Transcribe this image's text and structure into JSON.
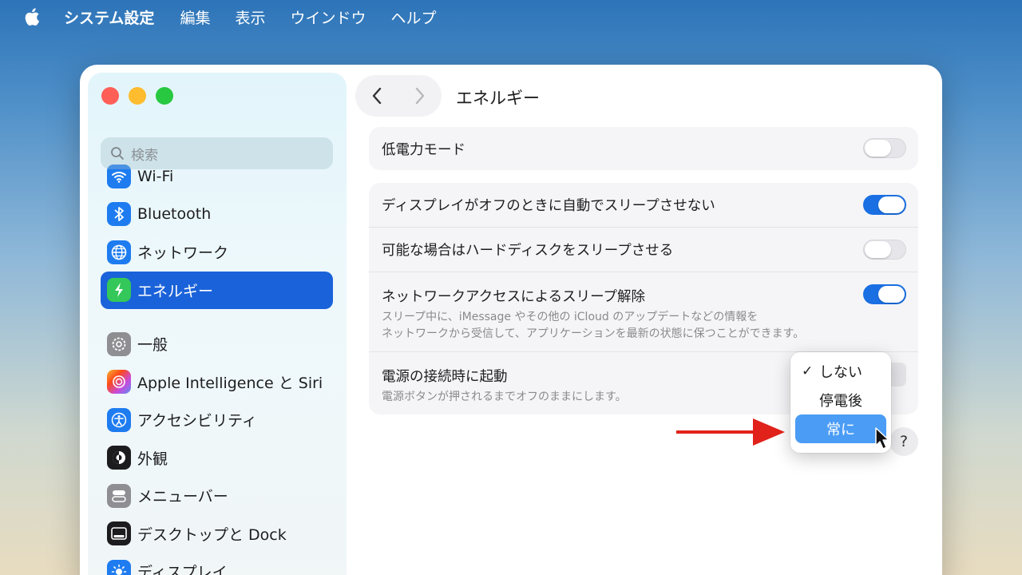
{
  "menubar": {
    "app": "システム設定",
    "items": [
      "編集",
      "表示",
      "ウインドウ",
      "ヘルプ"
    ]
  },
  "sidebar": {
    "search_placeholder": "検索",
    "items": [
      {
        "label": "Wi-Fi",
        "icon": "wifi-icon",
        "color": "#1e7cf0"
      },
      {
        "label": "Bluetooth",
        "icon": "bluetooth-icon",
        "color": "#1e7cf0"
      },
      {
        "label": "ネットワーク",
        "icon": "globe-icon",
        "color": "#1e7cf0"
      },
      {
        "label": "エネルギー",
        "icon": "bolt-icon",
        "color": "#34c759",
        "active": true
      },
      {
        "label": "一般",
        "icon": "gear-icon",
        "color": "#8e8e93"
      },
      {
        "label": "Apple Intelligence と Siri",
        "icon": "siri-icon",
        "color": "#f08a5d"
      },
      {
        "label": "アクセシビリティ",
        "icon": "accessibility-icon",
        "color": "#1e7cf0"
      },
      {
        "label": "外観",
        "icon": "appearance-icon",
        "color": "#1c1c1e"
      },
      {
        "label": "メニューバー",
        "icon": "menubar-icon",
        "color": "#8e8e93"
      },
      {
        "label": "デスクトップと Dock",
        "icon": "dock-icon",
        "color": "#1c1c1e"
      },
      {
        "label": "ディスプレイ",
        "icon": "display-icon",
        "color": "#1e7cf0"
      }
    ]
  },
  "main": {
    "title": "エネルギー",
    "low_power": {
      "label": "低電力モード",
      "on": false
    },
    "settings": [
      {
        "label": "ディスプレイがオフのときに自動でスリープさせない",
        "on": true
      },
      {
        "label": "可能な場合はハードディスクをスリープさせる",
        "on": false
      },
      {
        "label": "ネットワークアクセスによるスリープ解除",
        "on": true,
        "sub1": "スリープ中に、iMessage やその他の iCloud のアップデートなどの情報を",
        "sub2": "ネットワークから受信して、アプリケーションを最新の状態に保つことができます。"
      },
      {
        "label": "電源の接続時に起動",
        "sub1": "電源ボタンが押されるまでオフのままにします。"
      }
    ],
    "popup": {
      "options": [
        "しない",
        "停電後",
        "常に"
      ],
      "checked": "しない",
      "highlighted": "常に",
      "check_mark": "✓"
    },
    "help": "?"
  },
  "colors": {
    "accent": "#1a62d9",
    "arrow": "#e0221a"
  }
}
